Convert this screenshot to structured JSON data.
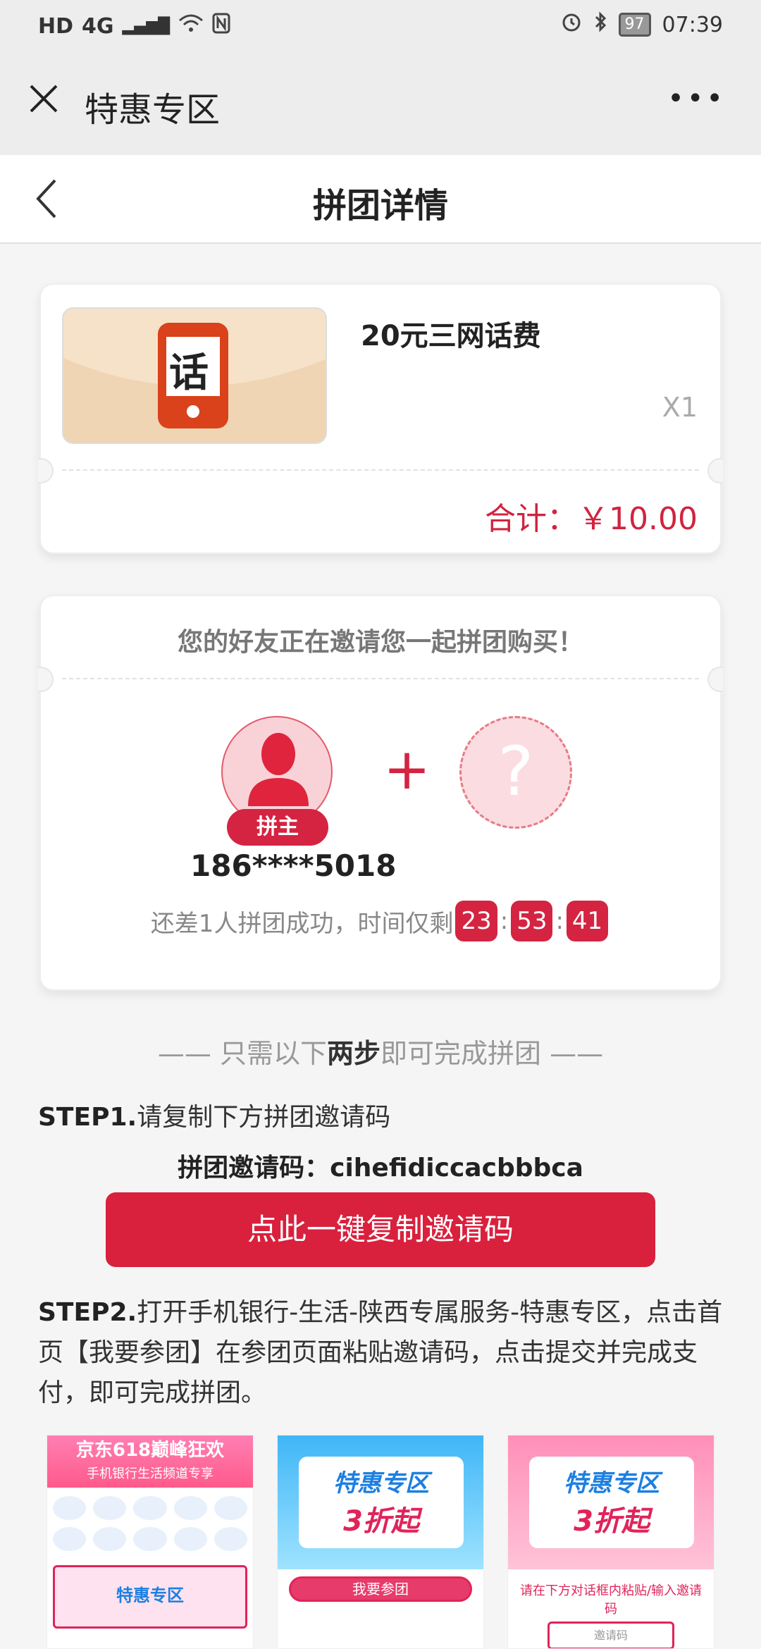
{
  "status": {
    "left": [
      "HD",
      "4G",
      "▂▄▆█",
      "WiFi",
      "NFC"
    ],
    "battery": "97",
    "time": "07:39"
  },
  "wechat_bar": {
    "title": "特惠专区",
    "more": "•••"
  },
  "nav": {
    "title": "拼团详情"
  },
  "product": {
    "image_text": "话",
    "name": "20元三网话费",
    "qty": "X1",
    "total": "合计：￥10.00"
  },
  "invite": {
    "title": "您的好友正在邀请您一起拼团购买！",
    "leader_badge": "拼主",
    "unknown_mark": "?",
    "plus": "+",
    "phone": "186****5018",
    "countdown_text": "还差1人拼团成功，时间仅剩",
    "hours": "23",
    "minutes": "53",
    "seconds": "41"
  },
  "steps": {
    "title_pre": "—— 只需以下",
    "title_bold": "两步",
    "title_post": "即可完成拼团 ——",
    "step1_label": "STEP1.",
    "step1_text": "请复制下方拼团邀请码",
    "code_label": "拼团邀请码：",
    "code_value": "cihefidiccacbbbca",
    "copy_button": "点此一键复制邀请码",
    "step2_label": "STEP2.",
    "step2_text": "打开手机银行-生活-陕西专属服务-特惠专区，点击首页【我要参团】在参团页面粘贴邀请码，点击提交并完成支付，即可完成拼团。"
  },
  "screens": {
    "s1_banner": "京东618巅峰狂欢",
    "s1_sub": "手机银行生活频道专享",
    "s2_title": "特惠专区",
    "s2_big": "3折起",
    "s2_button": "我要参团",
    "s3_title": "特惠专区",
    "s3_big": "3折起",
    "s3_tip": "请在下方对话框内粘贴/输入邀请码",
    "s3_input": "邀请码"
  },
  "colors": {
    "accent": "#d9203d",
    "bg": "#f5f5f5"
  }
}
